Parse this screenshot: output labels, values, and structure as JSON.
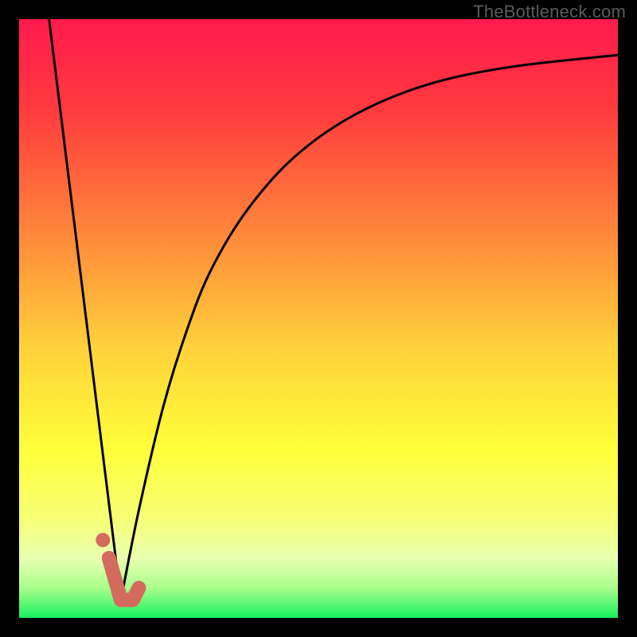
{
  "watermark": "TheBottleneck.com",
  "chart_data": {
    "type": "line",
    "title": "",
    "xlabel": "",
    "ylabel": "",
    "xlim": [
      0,
      100
    ],
    "ylim": [
      0,
      100
    ],
    "grid": false,
    "series": [
      {
        "name": "descending-line",
        "x": [
          5,
          17
        ],
        "y": [
          100,
          3
        ]
      },
      {
        "name": "ascending-curve",
        "x": [
          17,
          20,
          24,
          28,
          32,
          38,
          46,
          56,
          68,
          82,
          100
        ],
        "y": [
          3,
          18,
          35,
          48,
          58,
          68,
          77,
          84,
          89,
          92,
          94
        ]
      },
      {
        "name": "valley-marker",
        "x": [
          15,
          17,
          19,
          20
        ],
        "y": [
          10,
          3,
          3,
          5
        ]
      }
    ],
    "gradient_stops": [
      {
        "offset": 0.0,
        "color": "#ff1a4d"
      },
      {
        "offset": 0.15,
        "color": "#ff3a3e"
      },
      {
        "offset": 0.35,
        "color": "#ff843a"
      },
      {
        "offset": 0.55,
        "color": "#ffd23a"
      },
      {
        "offset": 0.72,
        "color": "#ffff3a"
      },
      {
        "offset": 0.84,
        "color": "#f6ff7a"
      },
      {
        "offset": 0.9,
        "color": "#e8ffb0"
      },
      {
        "offset": 0.95,
        "color": "#a8ff8a"
      },
      {
        "offset": 1.0,
        "color": "#18f060"
      }
    ],
    "marker_color": "#d46a5e"
  }
}
